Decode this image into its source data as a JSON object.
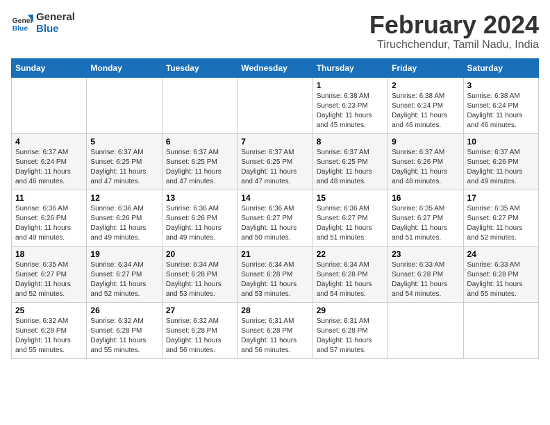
{
  "header": {
    "logo_general": "General",
    "logo_blue": "Blue",
    "main_title": "February 2024",
    "subtitle": "Tiruchchendur, Tamil Nadu, India"
  },
  "weekdays": [
    "Sunday",
    "Monday",
    "Tuesday",
    "Wednesday",
    "Thursday",
    "Friday",
    "Saturday"
  ],
  "weeks": [
    [
      {
        "day": "",
        "info": ""
      },
      {
        "day": "",
        "info": ""
      },
      {
        "day": "",
        "info": ""
      },
      {
        "day": "",
        "info": ""
      },
      {
        "day": "1",
        "info": "Sunrise: 6:38 AM\nSunset: 6:23 PM\nDaylight: 11 hours\nand 45 minutes."
      },
      {
        "day": "2",
        "info": "Sunrise: 6:38 AM\nSunset: 6:24 PM\nDaylight: 11 hours\nand 46 minutes."
      },
      {
        "day": "3",
        "info": "Sunrise: 6:38 AM\nSunset: 6:24 PM\nDaylight: 11 hours\nand 46 minutes."
      }
    ],
    [
      {
        "day": "4",
        "info": "Sunrise: 6:37 AM\nSunset: 6:24 PM\nDaylight: 11 hours\nand 46 minutes."
      },
      {
        "day": "5",
        "info": "Sunrise: 6:37 AM\nSunset: 6:25 PM\nDaylight: 11 hours\nand 47 minutes."
      },
      {
        "day": "6",
        "info": "Sunrise: 6:37 AM\nSunset: 6:25 PM\nDaylight: 11 hours\nand 47 minutes."
      },
      {
        "day": "7",
        "info": "Sunrise: 6:37 AM\nSunset: 6:25 PM\nDaylight: 11 hours\nand 47 minutes."
      },
      {
        "day": "8",
        "info": "Sunrise: 6:37 AM\nSunset: 6:25 PM\nDaylight: 11 hours\nand 48 minutes."
      },
      {
        "day": "9",
        "info": "Sunrise: 6:37 AM\nSunset: 6:26 PM\nDaylight: 11 hours\nand 48 minutes."
      },
      {
        "day": "10",
        "info": "Sunrise: 6:37 AM\nSunset: 6:26 PM\nDaylight: 11 hours\nand 49 minutes."
      }
    ],
    [
      {
        "day": "11",
        "info": "Sunrise: 6:36 AM\nSunset: 6:26 PM\nDaylight: 11 hours\nand 49 minutes."
      },
      {
        "day": "12",
        "info": "Sunrise: 6:36 AM\nSunset: 6:26 PM\nDaylight: 11 hours\nand 49 minutes."
      },
      {
        "day": "13",
        "info": "Sunrise: 6:36 AM\nSunset: 6:26 PM\nDaylight: 11 hours\nand 49 minutes."
      },
      {
        "day": "14",
        "info": "Sunrise: 6:36 AM\nSunset: 6:27 PM\nDaylight: 11 hours\nand 50 minutes."
      },
      {
        "day": "15",
        "info": "Sunrise: 6:36 AM\nSunset: 6:27 PM\nDaylight: 11 hours\nand 51 minutes."
      },
      {
        "day": "16",
        "info": "Sunrise: 6:35 AM\nSunset: 6:27 PM\nDaylight: 11 hours\nand 51 minutes."
      },
      {
        "day": "17",
        "info": "Sunrise: 6:35 AM\nSunset: 6:27 PM\nDaylight: 11 hours\nand 52 minutes."
      }
    ],
    [
      {
        "day": "18",
        "info": "Sunrise: 6:35 AM\nSunset: 6:27 PM\nDaylight: 11 hours\nand 52 minutes."
      },
      {
        "day": "19",
        "info": "Sunrise: 6:34 AM\nSunset: 6:27 PM\nDaylight: 11 hours\nand 52 minutes."
      },
      {
        "day": "20",
        "info": "Sunrise: 6:34 AM\nSunset: 6:28 PM\nDaylight: 11 hours\nand 53 minutes."
      },
      {
        "day": "21",
        "info": "Sunrise: 6:34 AM\nSunset: 6:28 PM\nDaylight: 11 hours\nand 53 minutes."
      },
      {
        "day": "22",
        "info": "Sunrise: 6:34 AM\nSunset: 6:28 PM\nDaylight: 11 hours\nand 54 minutes."
      },
      {
        "day": "23",
        "info": "Sunrise: 6:33 AM\nSunset: 6:28 PM\nDaylight: 11 hours\nand 54 minutes."
      },
      {
        "day": "24",
        "info": "Sunrise: 6:33 AM\nSunset: 6:28 PM\nDaylight: 11 hours\nand 55 minutes."
      }
    ],
    [
      {
        "day": "25",
        "info": "Sunrise: 6:32 AM\nSunset: 6:28 PM\nDaylight: 11 hours\nand 55 minutes."
      },
      {
        "day": "26",
        "info": "Sunrise: 6:32 AM\nSunset: 6:28 PM\nDaylight: 11 hours\nand 55 minutes."
      },
      {
        "day": "27",
        "info": "Sunrise: 6:32 AM\nSunset: 6:28 PM\nDaylight: 11 hours\nand 56 minutes."
      },
      {
        "day": "28",
        "info": "Sunrise: 6:31 AM\nSunset: 6:28 PM\nDaylight: 11 hours\nand 56 minutes."
      },
      {
        "day": "29",
        "info": "Sunrise: 6:31 AM\nSunset: 6:28 PM\nDaylight: 11 hours\nand 57 minutes."
      },
      {
        "day": "",
        "info": ""
      },
      {
        "day": "",
        "info": ""
      }
    ]
  ]
}
